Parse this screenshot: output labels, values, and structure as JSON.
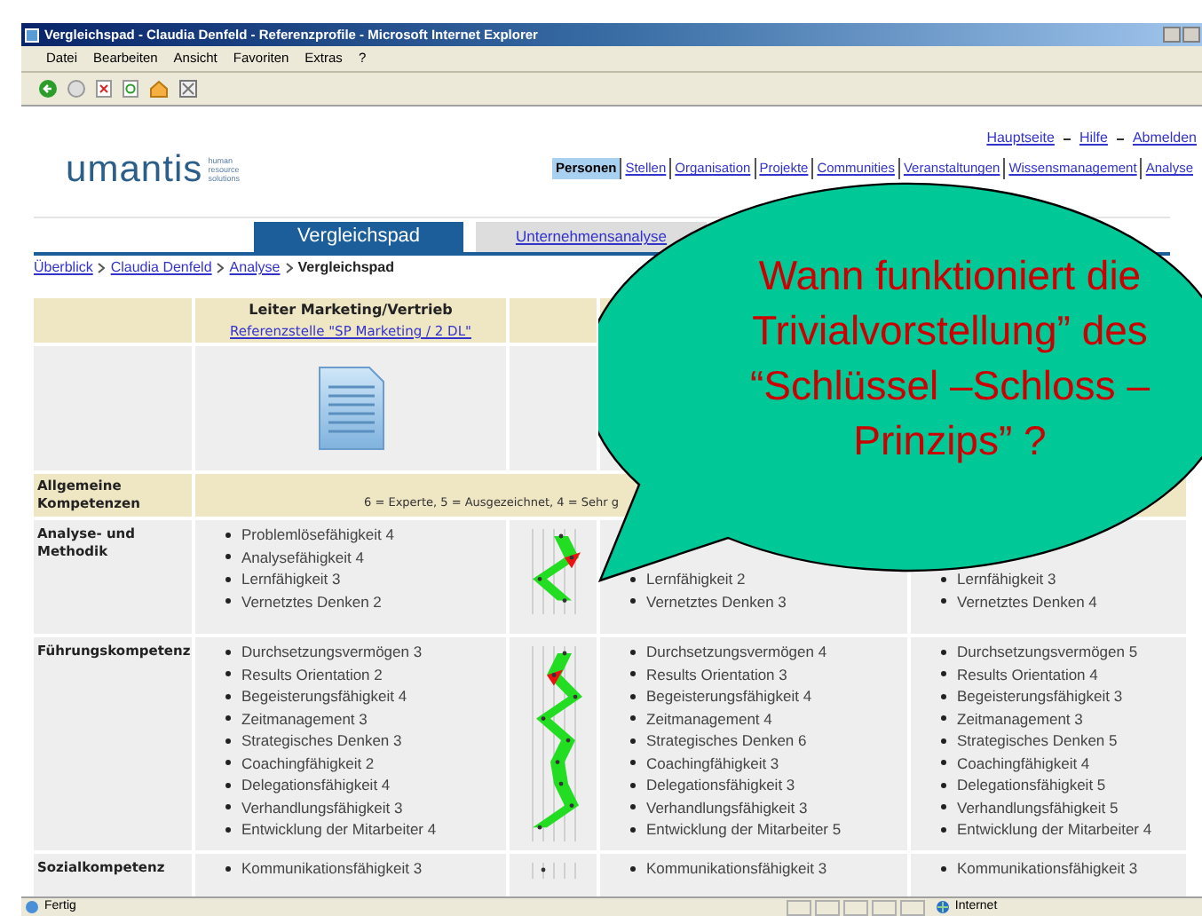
{
  "window": {
    "title": "Vergleichspad - Claudia Denfeld - Referenzprofile - Microsoft Internet Explorer"
  },
  "menu": [
    "Datei",
    "Bearbeiten",
    "Ansicht",
    "Favoriten",
    "Extras",
    "?"
  ],
  "header_links": [
    "Hauptseite",
    "Hilfe",
    "Abmelden"
  ],
  "logo": {
    "name": "umantis",
    "tagline": "human resource solutions"
  },
  "nav": [
    {
      "label": "Personen",
      "selected": true
    },
    {
      "label": "Stellen",
      "selected": false
    },
    {
      "label": "Organisation",
      "selected": false
    },
    {
      "label": "Projekte",
      "selected": false
    },
    {
      "label": "Communities",
      "selected": false
    },
    {
      "label": "Veranstaltungen",
      "selected": false
    },
    {
      "label": "Wissensmanagement",
      "selected": false
    },
    {
      "label": "Analyse",
      "selected": false
    }
  ],
  "tabs": [
    {
      "label": "Vergleichspad",
      "selected": true
    },
    {
      "label": "Unternehmensanalyse",
      "selected": false
    }
  ],
  "breadcrumb": [
    {
      "label": "Überblick",
      "kind": "link"
    },
    {
      "label": "Claudia Denfeld",
      "kind": "link"
    },
    {
      "label": "Analyse",
      "kind": "link"
    },
    {
      "label": "Vergleichspad",
      "kind": "current"
    }
  ],
  "table": {
    "column_1": {
      "title": "Leiter Marketing/Vertrieb",
      "link": "Referenzstelle \"SP Marketing / 2 DL\""
    },
    "section": {
      "label": "Allgemeine Kompetenzen",
      "legend": "6 = Experte, 5 = Ausgezeichnet, 4 = Sehr g"
    },
    "rows": [
      {
        "label": "Analyse- und Methodik",
        "column_1": [
          "Problemlösefähigkeit 4",
          "Analysefähigkeit 4",
          "Lernfähigkeit 3",
          "Vernetztes Denken 2"
        ],
        "column_2": [
          "Lernfähigkeit 2",
          "Vernetztes Denken 3"
        ],
        "column_3": [
          "Lernfähigkeit 3",
          "Vernetztes Denken 4"
        ]
      },
      {
        "label": "Führungskompetenz",
        "column_1": [
          "Durchsetzungsvermögen 3",
          "Results Orientation 2",
          "Begeisterungsfähigkeit 4",
          "Zeitmanagement 3",
          "Strategisches Denken 3",
          "Coachingfähigkeit 2",
          "Delegationsfähigkeit 4",
          "Verhandlungsfähigkeit 3",
          "Entwicklung der Mitarbeiter 4"
        ],
        "column_2": [
          "Durchsetzungsvermögen 4",
          "Results Orientation 3",
          "Begeisterungsfähigkeit 4",
          "Zeitmanagement 4",
          "Strategisches Denken 6",
          "Coachingfähigkeit 3",
          "Delegationsfähigkeit 3",
          "Verhandlungsfähigkeit 3",
          "Entwicklung der Mitarbeiter 5"
        ],
        "column_3": [
          "Durchsetzungsvermögen 5",
          "Results Orientation 4",
          "Begeisterungsfähigkeit 3",
          "Zeitmanagement 3",
          "Strategisches Denken 5",
          "Coachingfähigkeit 4",
          "Delegationsfähigkeit 5",
          "Verhandlungsfähigkeit 5",
          "Entwicklung der Mitarbeiter 4"
        ]
      },
      {
        "label": "Sozialkompetenz",
        "column_1": [
          "Kommunikationsfähigkeit 3"
        ],
        "column_2": [
          "Kommunikationsfähigkeit 3"
        ],
        "column_3": [
          "Kommunikationsfähigkeit 3"
        ]
      }
    ]
  },
  "callout": "Wann funktioniert die\nTrivialvorstellung” des\n“Schlüssel –Schloss –\nPrinzips” ?",
  "status_bar": {
    "text": "Fertig",
    "zone": "Internet"
  }
}
